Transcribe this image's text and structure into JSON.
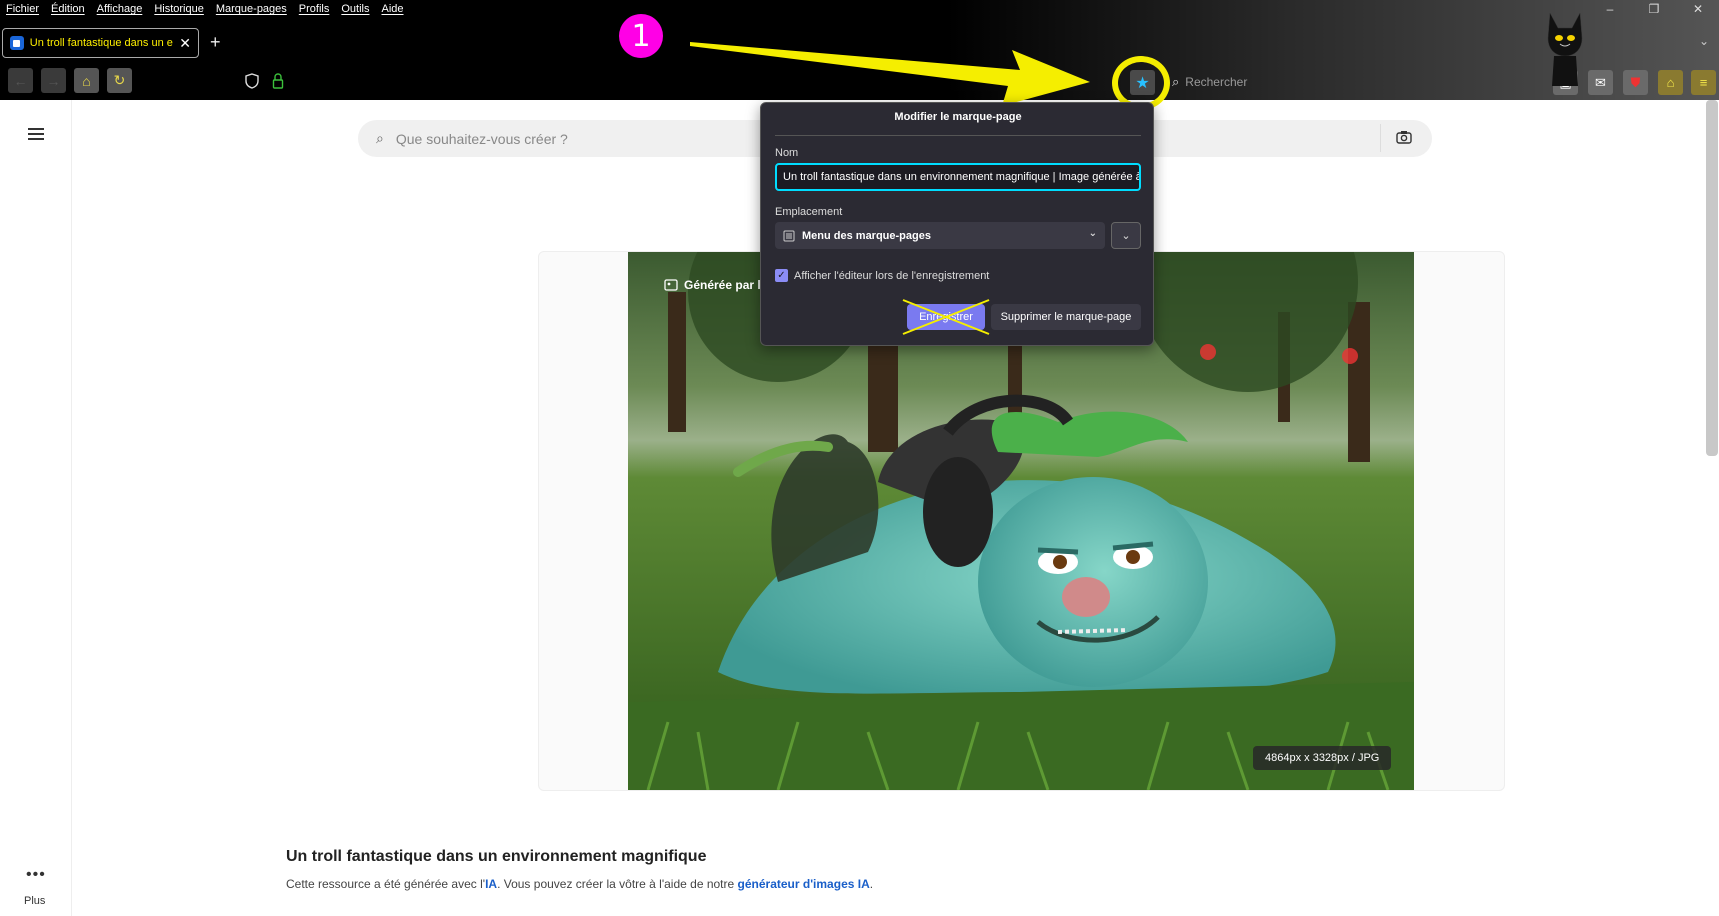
{
  "menubar": {
    "items": [
      "Fichier",
      "Édition",
      "Affichage",
      "Historique",
      "Marque-pages",
      "Profils",
      "Outils",
      "Aide"
    ]
  },
  "window_controls": {
    "minimize": "–",
    "restore": "❐",
    "close": "✕"
  },
  "tab": {
    "title": "Un troll fantastique dans un environnement magnifique",
    "close": "✕"
  },
  "new_tab": "+",
  "nav": {
    "back": "←",
    "forward": "→",
    "home": "⌂",
    "reload": "↻"
  },
  "bookmark_star": "★",
  "toolbar_search": {
    "placeholder": "Rechercher"
  },
  "annotation": {
    "step_number": "1"
  },
  "page_search": {
    "placeholder": "Que souhaitez-vous créer ?"
  },
  "image": {
    "generated_label": "Générée par l",
    "dimensions": "4864px x 3328px / JPG"
  },
  "content": {
    "title": "Un troll fantastique dans un environnement magnifique",
    "desc_prefix": "Cette ressource a été générée avec l'",
    "desc_ia": "IA",
    "desc_middle": ". Vous pouvez créer la vôtre à l'aide de notre ",
    "desc_link": "générateur d'images IA",
    "desc_suffix": "."
  },
  "sidebar": {
    "more_dots": "•••",
    "more_label": "Plus"
  },
  "bookmark_popup": {
    "title": "Modifier le marque-page",
    "name_label": "Nom",
    "name_value": "Un troll fantastique dans un environnement magnifique | Image générée à",
    "location_label": "Emplacement",
    "location_value": "Menu des marque-pages",
    "show_editor_label": "Afficher l'éditeur lors de l'enregistrement",
    "show_editor_checked": true,
    "save_label": "Enregistrer",
    "remove_label": "Supprimer le marque-page"
  },
  "colors": {
    "annotation_yellow": "#f5ee00",
    "annotation_magenta": "#ff00e6",
    "tab_title_color": "#fff000",
    "star_color": "#28c0ff",
    "save_button": "#7a7af0",
    "name_focus": "#00ddff",
    "link_color": "#1a5fc9"
  }
}
